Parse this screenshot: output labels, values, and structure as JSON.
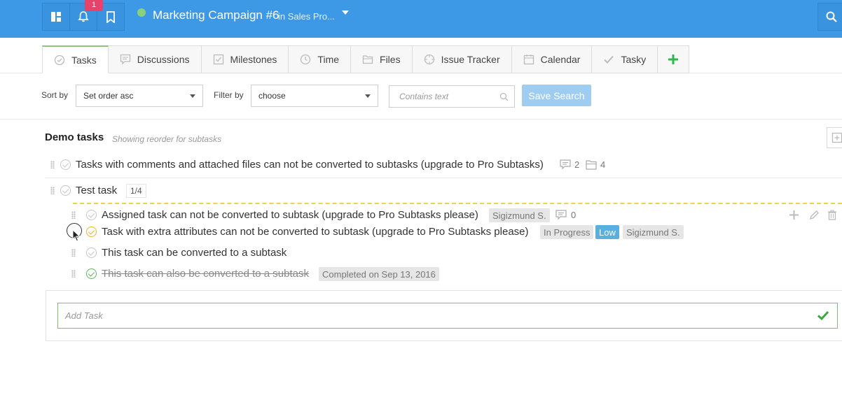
{
  "topbar": {
    "notification_count": "1",
    "project_title": "Marketing Campaign #6",
    "project_subtitle": "in Sales Pro...",
    "accent": "#3d98e5"
  },
  "tabs": [
    {
      "label": "Tasks",
      "icon": "check-circle-icon",
      "active": true
    },
    {
      "label": "Discussions",
      "icon": "chat-icon"
    },
    {
      "label": "Milestones",
      "icon": "checkbox-icon"
    },
    {
      "label": "Time",
      "icon": "clock-icon"
    },
    {
      "label": "Files",
      "icon": "folder-icon"
    },
    {
      "label": "Issue Tracker",
      "icon": "crosshair-icon"
    },
    {
      "label": "Calendar",
      "icon": "calendar-icon"
    },
    {
      "label": "Tasky",
      "icon": "checkmark-icon"
    }
  ],
  "filters": {
    "sort_label": "Sort by",
    "sort_value": "Set order asc",
    "filter_label": "Filter by",
    "filter_value": "choose",
    "search_placeholder": "Contains text",
    "save_search": "Save Search"
  },
  "list": {
    "title": "Demo tasks",
    "subtitle": "Showing reorder for subtasks"
  },
  "tasks": [
    {
      "text": "Tasks with comments and attached files can not be converted to subtasks (upgrade to Pro Subtasks)",
      "comments": "2",
      "files": "4"
    },
    {
      "text": "Test task",
      "progress": "1/4"
    }
  ],
  "subtasks": [
    {
      "text": "Assigned task can not be converted to subtask (upgrade to Pro Subtasks please)",
      "assignee": "Sigizmund S.",
      "comments": "0"
    },
    {
      "text": "Task with extra attributes can not be converted to subtask (upgrade to Pro Subtasks please)",
      "status": "In Progress",
      "priority": "Low",
      "assignee": "Sigizmund S."
    },
    {
      "text": "This task can be converted to a subtask"
    },
    {
      "text": "This task can also be converted to a subtask",
      "completed": "Completed on Sep 13, 2016"
    }
  ],
  "add_task": {
    "placeholder": "Add Task"
  }
}
